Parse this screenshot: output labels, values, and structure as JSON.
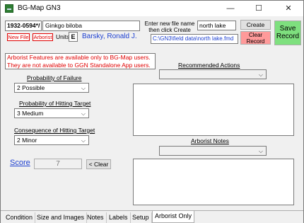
{
  "window": {
    "title": "BG-Map GN3",
    "minimize": "—",
    "maximize": "☐",
    "close": "✕"
  },
  "plant": {
    "accession": "1932-0594*/",
    "name": "Ginkgo biloba"
  },
  "new_file_prompt": "Enter new file name then click Create",
  "new_file_value": "north lake",
  "create_file_label": "Create File",
  "clear_record_label": "Clear Record",
  "save_record_label": "Save Record",
  "new_file_label": "New File",
  "arborist_label": "Arborist",
  "units_label": "Units",
  "units_value": "E",
  "user_name": "Barsky, Ronald J.",
  "file_path": "C:\\GN3\\field data\\north lake.fmd",
  "warning_line1": "Arborist Features are available only to BG-Map users.",
  "warning_line2": "They are not available to GGN Standalone App users.",
  "prob_failure": {
    "label": "Probability of Failure",
    "value": "2 Possible"
  },
  "prob_hitting": {
    "label": "Probability of Hitting Target",
    "value": "3 Medium"
  },
  "consequence": {
    "label": "Consequence of Hitting Target",
    "value": "2 Minor"
  },
  "score": {
    "label": "Score",
    "value": "7",
    "clear_label": "< Clear"
  },
  "recommended_actions": {
    "label": "Recommended Actions",
    "value": ""
  },
  "arborist_notes": {
    "label": "Arborist Notes",
    "value": ""
  },
  "tabs": [
    "Condition",
    "Size and Images",
    "Notes",
    "Labels",
    "Setup",
    "Arborist Only"
  ],
  "active_tab": "Arborist Only",
  "colors": {
    "warning_red": "#e00000",
    "link_blue": "#1c3fd0",
    "save_green": "#7ee07e",
    "clear_red": "#ff9a9a"
  }
}
